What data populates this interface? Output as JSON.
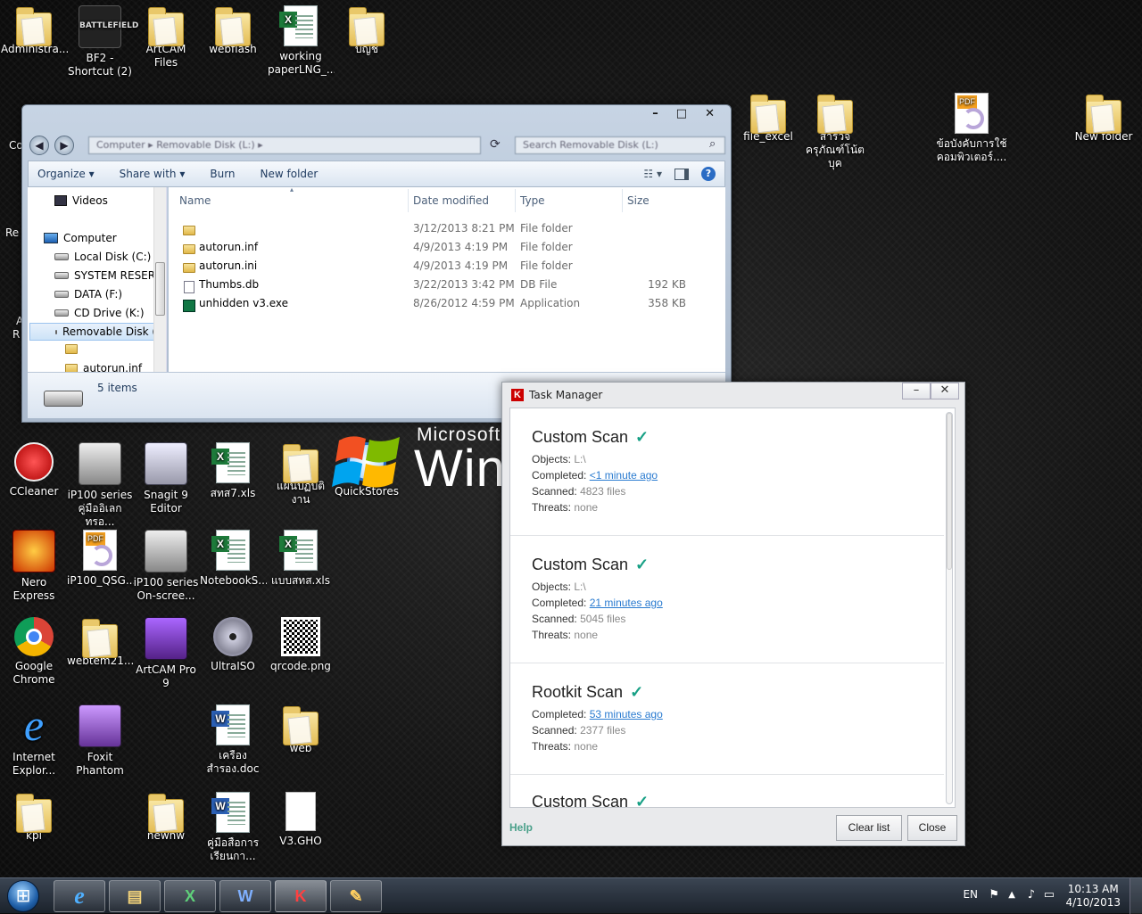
{
  "desktop": {
    "icons": [
      {
        "label": "Administra..."
      },
      {
        "label": "BF2 - Shortcut (2)",
        "logo_text": "BATTLEFIELD"
      },
      {
        "label": "ArtCAM Files"
      },
      {
        "label": "webflash"
      },
      {
        "label": "working paperLNG_..."
      },
      {
        "label": "บัญชี"
      },
      {
        "label": "file_excel"
      },
      {
        "label": "สำรวจครุภัณฑ์โน้ตบุค"
      },
      {
        "label": "ข้อบังคับการใช้คอมพิวเตอร์...."
      },
      {
        "label": "New folder"
      },
      {
        "label": "CCleaner"
      },
      {
        "label": "iP100 series คู่มืออิเลกทรอ..."
      },
      {
        "label": "Snagit 9 Editor"
      },
      {
        "label": "สทส7.xls"
      },
      {
        "label": "แผนปฏิบัติงาน"
      },
      {
        "label": "QuickStores"
      },
      {
        "label": "Nero Express"
      },
      {
        "label": "iP100_QSG..."
      },
      {
        "label": "iP100 series On-scree..."
      },
      {
        "label": "NotebookS..."
      },
      {
        "label": "แบบสทส.xls"
      },
      {
        "label": "Google Chrome"
      },
      {
        "label": "webtem21..."
      },
      {
        "label": "ArtCAM Pro 9"
      },
      {
        "label": "UltraISO"
      },
      {
        "label": "qrcode.png"
      },
      {
        "label": "Internet Explor..."
      },
      {
        "label": "Foxit Phantom"
      },
      {
        "label": "เครือง สำรอง.doc"
      },
      {
        "label": "web"
      },
      {
        "label": "kpi"
      },
      {
        "label": "newhw"
      },
      {
        "label": "คู่มือสื่อการเรียนกา..."
      },
      {
        "label": "V3.GHO"
      }
    ],
    "partial_labels": {
      "left_1": "Co",
      "left_2": "Re",
      "left_3": "A",
      "left_4": "R"
    },
    "windows_logo": {
      "line1": "Microsoft",
      "line2": "Win"
    }
  },
  "explorer": {
    "caption_buttons": {
      "minimize": "–",
      "maximize": "□",
      "close": "✕"
    },
    "address": "Computer ▸ Removable Disk (L:) ▸",
    "search_placeholder": "Search Removable Disk (L:)",
    "toolbar": {
      "organize": "Organize ▾",
      "share_with": "Share with ▾",
      "burn": "Burn",
      "new_folder": "New folder",
      "help": "?"
    },
    "nav_tree": [
      {
        "label": "Videos"
      },
      {
        "label": "Computer"
      },
      {
        "label": "Local Disk (C:)"
      },
      {
        "label": "SYSTEM RESERVE"
      },
      {
        "label": "DATA (F:)"
      },
      {
        "label": "CD Drive (K:)"
      },
      {
        "label": "Removable Disk ("
      },
      {
        "label": ""
      },
      {
        "label": "autorun.inf"
      }
    ],
    "columns": {
      "name": "Name",
      "date": "Date modified",
      "type": "Type",
      "size": "Size"
    },
    "files": [
      {
        "name": "",
        "date": "3/12/2013 8:21 PM",
        "type": "File folder",
        "size": ""
      },
      {
        "name": "autorun.inf",
        "date": "4/9/2013 4:19 PM",
        "type": "File folder",
        "size": ""
      },
      {
        "name": "autorun.ini",
        "date": "4/9/2013 4:19 PM",
        "type": "File folder",
        "size": ""
      },
      {
        "name": "Thumbs.db",
        "date": "3/22/2013 3:42 PM",
        "type": "DB File",
        "size": "192 KB"
      },
      {
        "name": "unhidden v3.exe",
        "date": "8/26/2012 4:59 PM",
        "type": "Application",
        "size": "358 KB"
      }
    ],
    "status": "5 items"
  },
  "task_manager": {
    "title": "Task Manager",
    "logo": "K",
    "buttons": {
      "minimize": "–",
      "close": "✕",
      "clear_list": "Clear list",
      "close_btn": "Close",
      "help": "Help"
    },
    "labels": {
      "objects": "Objects:",
      "completed": "Completed:",
      "scanned": "Scanned:",
      "threats": "Threats:"
    },
    "check_mark": "✓",
    "entries": [
      {
        "title": "Custom Scan",
        "objects": "L:\\",
        "completed": "<1 minute ago",
        "scanned": "4823 files",
        "threats": "none"
      },
      {
        "title": "Custom Scan",
        "objects": "L:\\",
        "completed": "21 minutes ago",
        "scanned": "5045 files",
        "threats": "none"
      },
      {
        "title": "Rootkit Scan",
        "completed": "53 minutes ago",
        "scanned": "2377 files",
        "threats": "none"
      },
      {
        "title": "Custom Scan"
      }
    ]
  },
  "taskbar": {
    "buttons": [
      {
        "icon": "internet-explorer-icon",
        "glyph": "e"
      },
      {
        "icon": "explorer-icon",
        "glyph": "▤"
      },
      {
        "icon": "excel-icon",
        "glyph": "X"
      },
      {
        "icon": "word-icon",
        "glyph": "W"
      },
      {
        "icon": "kaspersky-icon",
        "glyph": "K"
      },
      {
        "icon": "paint-icon",
        "glyph": "✎"
      }
    ],
    "tray": {
      "lang": "EN",
      "time": "10:13 AM",
      "date": "4/10/2013"
    }
  },
  "colors": {
    "kaspersky_green": "#17a085",
    "link_blue": "#2a7bd0",
    "excel_green": "#1d7a3a",
    "word_blue": "#2b5fb3"
  }
}
